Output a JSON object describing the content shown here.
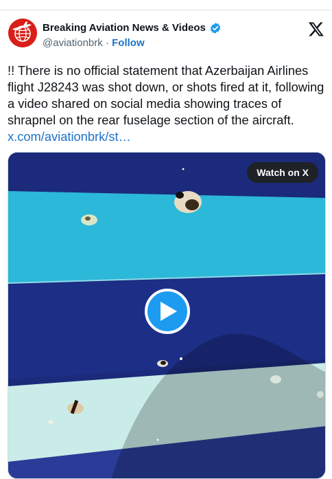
{
  "tweet": {
    "author_name": "Breaking Aviation News & Videos",
    "handle": "@aviationbrk",
    "separator": " · ",
    "follow_label": "Follow",
    "text": "!! There is no official statement that Azerbaijan Airlines flight J28243 was shot down, or shots fired at it, following a video shared on social media showing traces of shrapnel on the rear fuselage section of the aircraft. ",
    "link_text": "x.com/aviationbrk/st…",
    "avatar_icon": "globe-airplane-logo",
    "verified_icon": "verified-badge-icon",
    "brand_icon": "x-logo-icon"
  },
  "media": {
    "watch_label": "Watch on X",
    "play_icon": "play-icon"
  },
  "colors": {
    "link": "#1d72c9",
    "verified": "#1d9bf0",
    "avatar_bg": "#d91e18",
    "fuselage_blue": "#1b2a7a",
    "stripe_cyan": "#2cb8d8",
    "stripe_pale": "#c9ece8"
  }
}
